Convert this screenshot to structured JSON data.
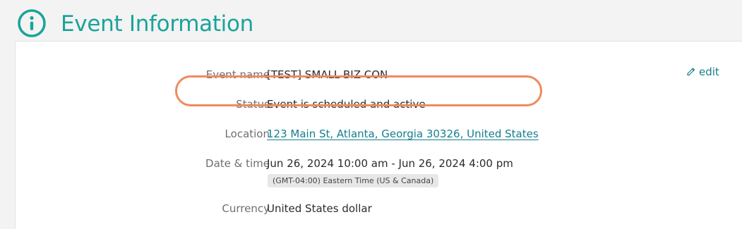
{
  "header": {
    "title": "Event Information",
    "icon": "info-icon",
    "accent_color": "#1aa39a"
  },
  "actions": {
    "edit_label": "edit",
    "edit_icon": "pencil-icon"
  },
  "fields": {
    "event_name": {
      "label": "Event name",
      "value": "[TEST] SMALL BIZ CON"
    },
    "status": {
      "label": "Status",
      "value": "Event is scheduled and active"
    },
    "location": {
      "label": "Location",
      "value": "123 Main St, Atlanta, Georgia 30326, United States"
    },
    "date_time": {
      "label": "Date & time",
      "value": "Jun 26, 2024 10:00 am - Jun 26, 2024 4:00 pm",
      "timezone": "(GMT-04:00) Eastern Time (US & Canada)"
    },
    "currency": {
      "label": "Currency",
      "value": "United States dollar"
    }
  },
  "annotation": {
    "highlight_color": "#f08a5d"
  }
}
